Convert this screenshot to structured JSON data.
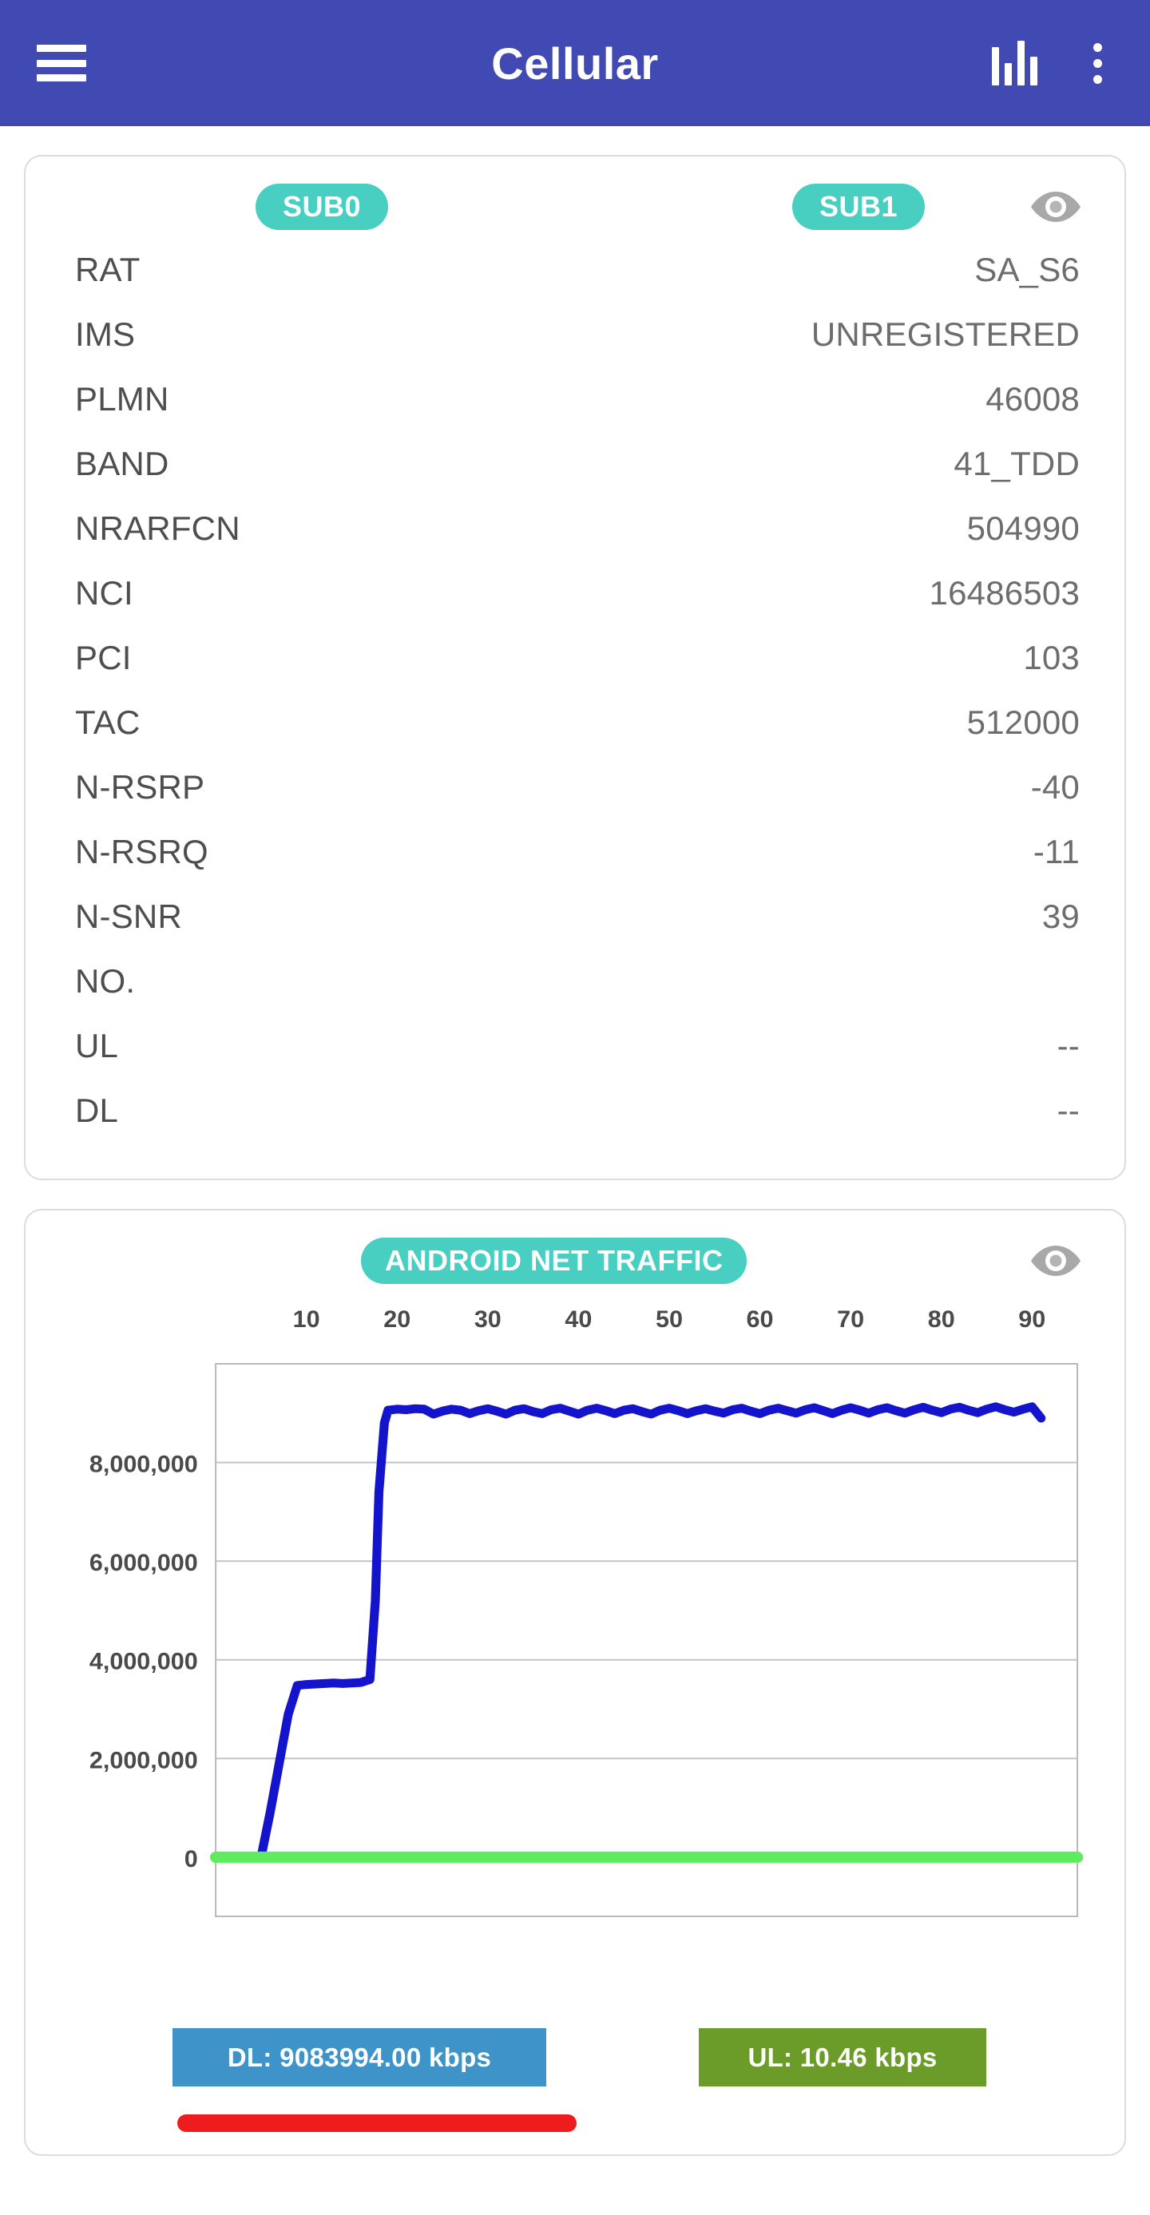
{
  "appbar": {
    "title": "Cellular",
    "menu_icon": "hamburger-menu-icon",
    "chart_icon": "bar-chart-icon",
    "overflow_icon": "more-vertical-icon"
  },
  "info_card": {
    "tabs": [
      {
        "label": "SUB0"
      },
      {
        "label": "SUB1"
      }
    ],
    "visibility_icon": "eye-icon",
    "rows": [
      {
        "label": "RAT",
        "value": "SA_S6"
      },
      {
        "label": "IMS",
        "value": "UNREGISTERED"
      },
      {
        "label": "PLMN",
        "value": "46008"
      },
      {
        "label": "BAND",
        "value": "41_TDD"
      },
      {
        "label": "NRARFCN",
        "value": "504990"
      },
      {
        "label": "NCI",
        "value": "16486503"
      },
      {
        "label": "PCI",
        "value": "103"
      },
      {
        "label": "TAC",
        "value": "512000"
      },
      {
        "label": "N-RSRP",
        "value": "-40"
      },
      {
        "label": "N-RSRQ",
        "value": "-11"
      },
      {
        "label": "N-SNR",
        "value": "39"
      },
      {
        "label": "NO.",
        "value": ""
      },
      {
        "label": "UL",
        "value": "--"
      },
      {
        "label": "DL",
        "value": "--"
      }
    ]
  },
  "traffic_card": {
    "title": "ANDROID NET TRAFFIC",
    "visibility_icon": "eye-icon",
    "legend": {
      "dl_label": "DL: 9083994.00 kbps",
      "ul_label": "UL: 10.46 kbps",
      "dl_color": "#3e93c8",
      "ul_color": "#6b9b28",
      "marker_color": "#ee1c1c"
    }
  },
  "colors": {
    "appbar": "#4149b2",
    "pill_teal": "#48cfc2",
    "dl_line": "#1414cc",
    "ul_line": "#5eeb5e"
  },
  "chart_data": {
    "type": "line",
    "title": "ANDROID NET TRAFFIC",
    "xlabel": "",
    "ylabel": "",
    "xlim": [
      0,
      95
    ],
    "ylim": [
      -1200000,
      10000000
    ],
    "xticks": [
      10,
      20,
      30,
      40,
      50,
      60,
      70,
      80,
      90
    ],
    "xtick_labels": [
      "10",
      "20",
      "30",
      "40",
      "50",
      "60",
      "70",
      "80",
      "90"
    ],
    "yticks": [
      0,
      2000000,
      4000000,
      6000000,
      8000000
    ],
    "ytick_labels": [
      "0",
      "2,000,000",
      "4,000,000",
      "6,000,000",
      "8,000,000"
    ],
    "grid": true,
    "legend_position": "bottom",
    "series": [
      {
        "name": "DL",
        "color": "#1414cc",
        "x": [
          5,
          6,
          7,
          8,
          9,
          10,
          11,
          12,
          13,
          14,
          15,
          16,
          17,
          17.6,
          18,
          18.6,
          19,
          20,
          21,
          22,
          23,
          24,
          25,
          26,
          27,
          28,
          29,
          30,
          31,
          32,
          33,
          34,
          35,
          36,
          37,
          38,
          39,
          40,
          41,
          42,
          43,
          44,
          45,
          46,
          47,
          48,
          49,
          50,
          51,
          52,
          53,
          54,
          55,
          56,
          57,
          58,
          59,
          60,
          61,
          62,
          63,
          64,
          65,
          66,
          67,
          68,
          69,
          70,
          71,
          72,
          73,
          74,
          75,
          76,
          77,
          78,
          79,
          80,
          81,
          82,
          83,
          84,
          85,
          86,
          87,
          88,
          89,
          90,
          91
        ],
        "y": [
          0,
          900000,
          1900000,
          2900000,
          3480000,
          3500000,
          3510000,
          3520000,
          3530000,
          3520000,
          3530000,
          3540000,
          3600000,
          5200000,
          7400000,
          8800000,
          9060000,
          9080000,
          9070000,
          9090000,
          9080000,
          8980000,
          9040000,
          9080000,
          9060000,
          8990000,
          9050000,
          9090000,
          9040000,
          8980000,
          9060000,
          9090000,
          9030000,
          8990000,
          9070000,
          9100000,
          9040000,
          8980000,
          9060000,
          9100000,
          9050000,
          8990000,
          9060000,
          9090000,
          9030000,
          8980000,
          9060000,
          9100000,
          9050000,
          8990000,
          9050000,
          9090000,
          9040000,
          9000000,
          9070000,
          9100000,
          9040000,
          8990000,
          9060000,
          9100000,
          9050000,
          9000000,
          9070000,
          9110000,
          9050000,
          8990000,
          9060000,
          9110000,
          9060000,
          9000000,
          9070000,
          9110000,
          9050000,
          9000000,
          9070000,
          9120000,
          9060000,
          9010000,
          9080000,
          9120000,
          9060000,
          9010000,
          9080000,
          9130000,
          9070000,
          9020000,
          9080000,
          9130000,
          8900000,
          9150000
        ]
      },
      {
        "name": "UL",
        "color": "#5eeb5e",
        "x": [
          0,
          95
        ],
        "y": [
          0,
          0
        ]
      }
    ]
  }
}
